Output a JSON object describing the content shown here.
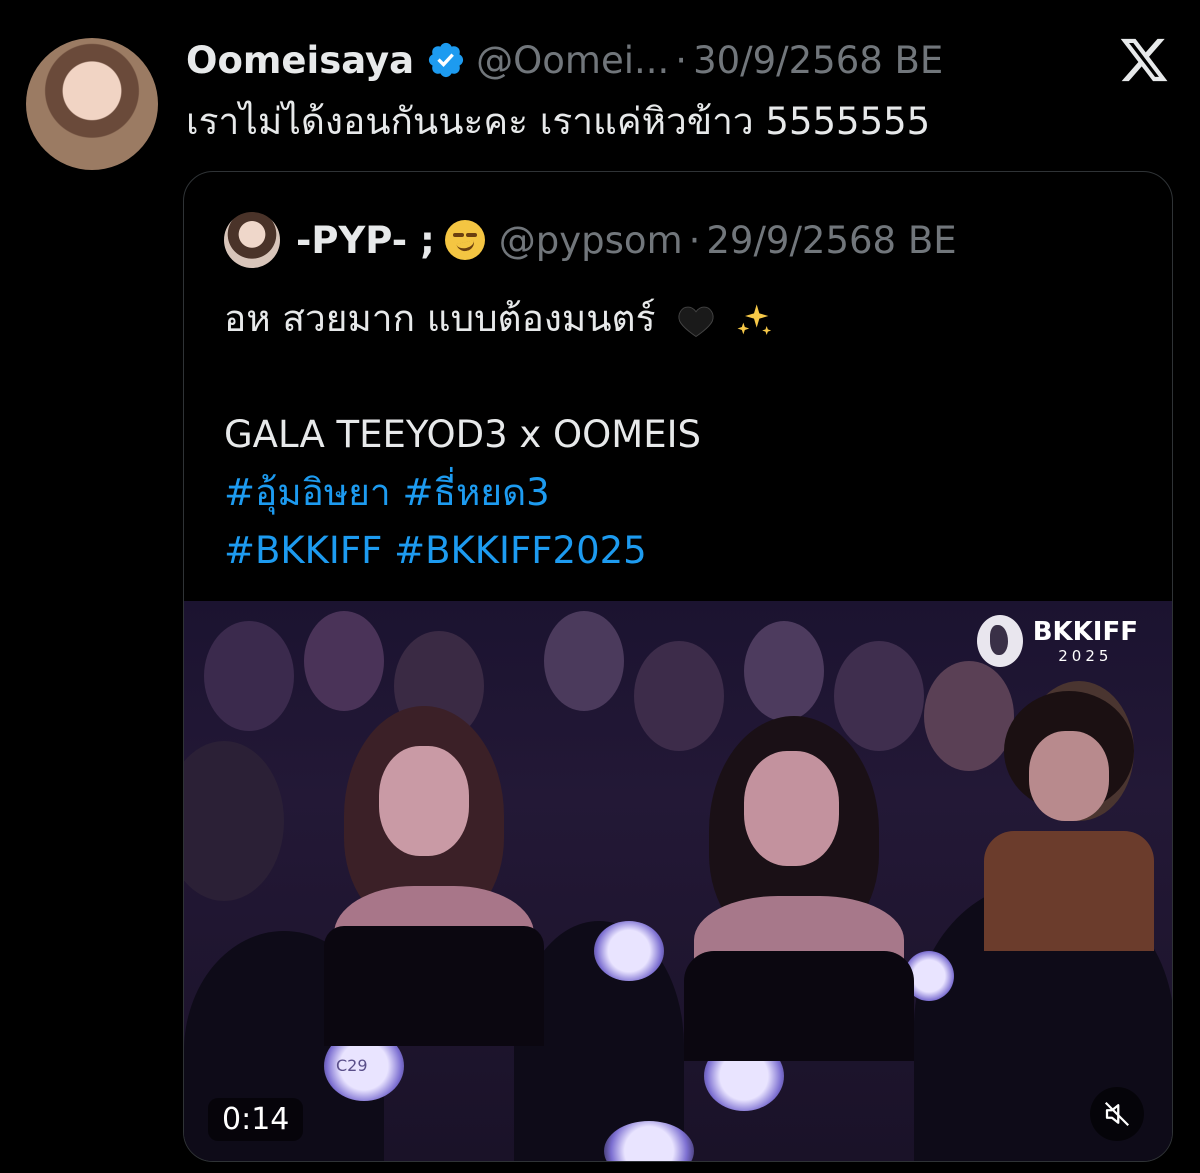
{
  "tweet": {
    "author_name": "Oomeisaya",
    "author_handle": "@Oomei...",
    "date": "30/9/2568 BE",
    "separator": "·",
    "text": "เราไม่ได้งอนกันนะคะ เราแค่หิวข้าว 5555555",
    "verified": true
  },
  "quoted_tweet": {
    "author_name": "-PYP- ;",
    "author_emoji": "smirking-face",
    "author_handle": "@pypsom",
    "date": "29/9/2568 BE",
    "separator": "·",
    "line1_text": "อห สวยมาก แบบต้องมนตร์",
    "line1_emojis": [
      "black-heart",
      "sparkles"
    ],
    "line2_text": "GALA TEEYOD3 x OOMEIS",
    "hashtags_line1": "#อุ้มอิษยา #ธี่หยด3",
    "hashtags_line2": "#BKKIFF #BKKIFF2025"
  },
  "media": {
    "watermark_title": "BKKIFF",
    "watermark_year": "2025",
    "seat_label": "C29",
    "duration": "0:14",
    "muted": true
  },
  "colors": {
    "background": "#000000",
    "text_primary": "#e7e9ea",
    "text_secondary": "#71767b",
    "link": "#1d9bf0",
    "verified": "#1d9bf0",
    "border": "#2f3336"
  },
  "icons": {
    "verified": "verified-badge-icon",
    "platform": "x-logo-icon",
    "mute": "muted-speaker-icon"
  }
}
